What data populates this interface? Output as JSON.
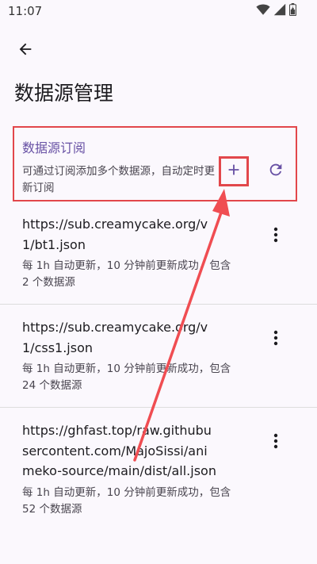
{
  "status_bar": {
    "time": "11:07",
    "icons": [
      "wifi-icon",
      "signal-icon",
      "battery-icon"
    ]
  },
  "app_bar": {
    "back_icon": "arrow-back-icon",
    "title": "数据源管理"
  },
  "section": {
    "title": "数据源订阅",
    "description": "可通过订阅添加多个数据源，自动定时更新订阅",
    "add_icon": "plus-icon",
    "refresh_icon": "refresh-icon"
  },
  "subscriptions": [
    {
      "url": "https://sub.creamycake.org/v1/bt1.json",
      "status": "每 1h 自动更新，10 分钟前更新成功，包含 2 个数据源"
    },
    {
      "url": "https://sub.creamycake.org/v1/css1.json",
      "status": "每 1h 自动更新，10 分钟前更新成功，包含 24 个数据源"
    },
    {
      "url": "https://ghfast.top/raw.githubusercontent.com/MajoSissi/animeko-source/main/dist/all.json",
      "status": "每 1h 自动更新，10 分钟前更新成功，包含 52 个数据源"
    }
  ],
  "colors": {
    "accent": "#6750a4",
    "highlight": "#e2474b",
    "background": "#fbf8fd"
  }
}
